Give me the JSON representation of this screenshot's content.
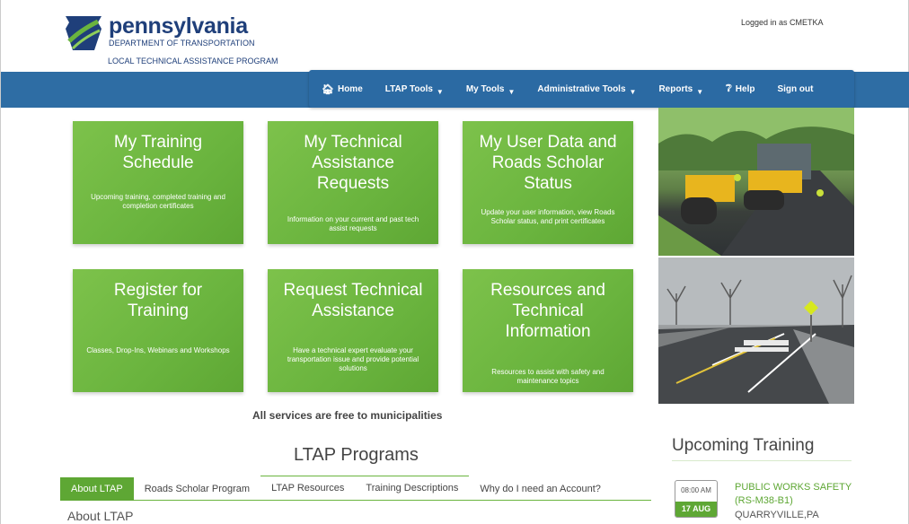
{
  "header": {
    "logo_main": "pennsylvania",
    "logo_sub1": "DEPARTMENT OF TRANSPORTATION",
    "logo_sub2": "LOCAL TECHNICAL ASSISTANCE PROGRAM",
    "logged_in": "Logged in as CMETKA"
  },
  "nav": {
    "items": [
      {
        "label": "Home",
        "icon": "home-icon"
      },
      {
        "label": "LTAP Tools",
        "caret": true
      },
      {
        "label": "My Tools",
        "caret": true
      },
      {
        "label": "Administrative Tools",
        "caret": true
      },
      {
        "label": "Reports",
        "caret": true
      },
      {
        "label": "Help",
        "icon": "help-icon"
      },
      {
        "label": "Sign out"
      }
    ]
  },
  "tiles": [
    {
      "title": "My Training Schedule",
      "desc": "Upcoming training, completed training and completion certificates"
    },
    {
      "title": "My Technical Assistance Requests",
      "desc": "Information on your current and past tech assist requests"
    },
    {
      "title": "My User Data and Roads Scholar Status",
      "desc": "Update your user information, view Roads Scholar status, and print certificates"
    },
    {
      "title": "Register for Training",
      "desc": "Classes, Drop-Ins, Webinars and Workshops"
    },
    {
      "title": "Request Technical Assistance",
      "desc": "Have a technical expert evaluate your transportation issue and provide potential solutions"
    },
    {
      "title": "Resources and Technical Information",
      "desc": "Resources to assist with safety and maintenance topics"
    }
  ],
  "free_note": "All services are free to municipalities",
  "programs": {
    "title": "LTAP Programs",
    "tabs": [
      "About LTAP",
      "Roads Scholar Program",
      "LTAP Resources",
      "Training Descriptions",
      "Why do I need an Account?"
    ],
    "active_heading": "About LTAP"
  },
  "upcoming": {
    "title": "Upcoming Training",
    "events": [
      {
        "time": "08:00 AM",
        "date": "17 AUG",
        "name": "PUBLIC WORKS SAFETY (RS-M38-B1)",
        "location": "QUARRYVILLE,PA"
      }
    ]
  },
  "colors": {
    "nav_blue": "#2e6da4",
    "tile_green": "#6ab43e",
    "brand_navy": "#1f3f7a"
  }
}
